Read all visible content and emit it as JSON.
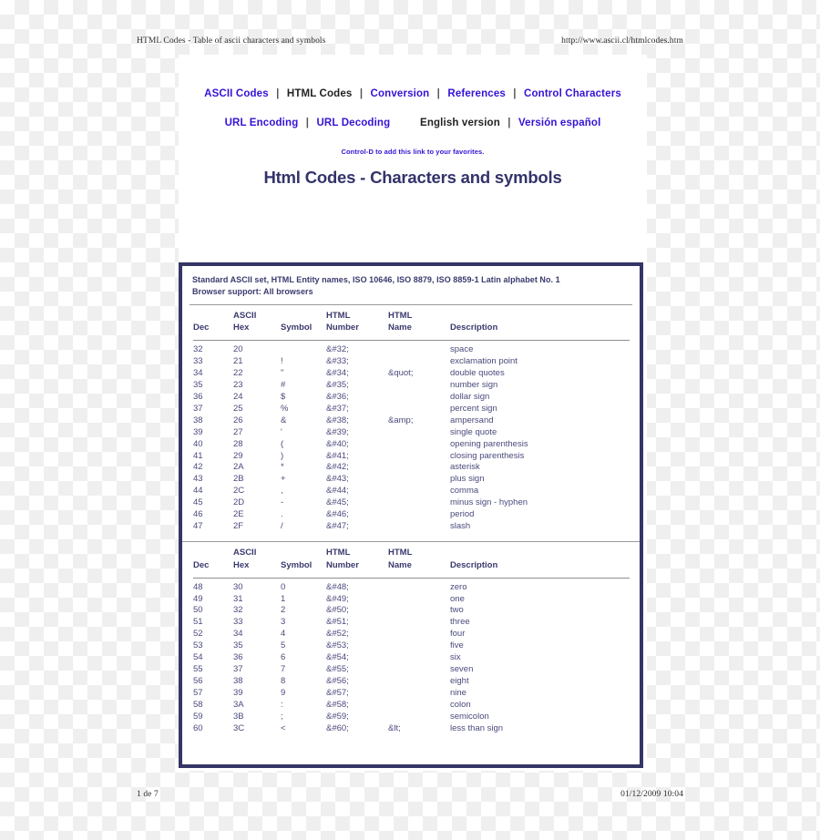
{
  "running_head": {
    "left": "HTML Codes - Table of ascii characters and symbols",
    "right": "http://www.ascii.cl/htmlcodes.htm"
  },
  "running_foot": {
    "left": "1 de 7",
    "right": "01/12/2009 10:04"
  },
  "nav": {
    "row1": [
      {
        "label": "ASCII Codes",
        "current": false
      },
      {
        "label": "HTML Codes",
        "current": true
      },
      {
        "label": "Conversion",
        "current": false
      },
      {
        "label": "References",
        "current": false
      },
      {
        "label": "Control Characters",
        "current": false
      }
    ],
    "row2_left": [
      {
        "label": "URL Encoding",
        "current": false
      },
      {
        "label": "URL Decoding",
        "current": false
      }
    ],
    "row2_right": [
      {
        "label": "English version",
        "current": true
      },
      {
        "label": "Versión español",
        "current": false
      }
    ],
    "separator": "|"
  },
  "favorites_tip": "Control-D to add this link to your favorites.",
  "page_title": "Html Codes - Characters and symbols",
  "table_box": {
    "meta_line1": "Standard ASCII set, HTML Entity names, ISO 10646, ISO 8879, ISO 8859-1 Latin alphabet No. 1",
    "meta_line2": "Browser support: All browsers",
    "headers": {
      "group": "ASCII",
      "dec": "Dec",
      "hex": "Hex",
      "symbol": "Symbol",
      "html_number_l1": "HTML",
      "html_number_l2": "Number",
      "html_name_l1": "HTML",
      "html_name_l2": "Name",
      "description": "Description"
    },
    "section1": [
      {
        "dec": "32",
        "hex": "20",
        "symbol": "",
        "number": "&#32;",
        "name": "",
        "description": "space"
      },
      {
        "dec": "33",
        "hex": "21",
        "symbol": "!",
        "number": "&#33;",
        "name": "",
        "description": "exclamation point"
      },
      {
        "dec": "34",
        "hex": "22",
        "symbol": "\"",
        "number": "&#34;",
        "name": "&quot;",
        "description": "double quotes"
      },
      {
        "dec": "35",
        "hex": "23",
        "symbol": "#",
        "number": "&#35;",
        "name": "",
        "description": "number sign"
      },
      {
        "dec": "36",
        "hex": "24",
        "symbol": "$",
        "number": "&#36;",
        "name": "",
        "description": "dollar sign"
      },
      {
        "dec": "37",
        "hex": "25",
        "symbol": "%",
        "number": "&#37;",
        "name": "",
        "description": "percent sign"
      },
      {
        "dec": "38",
        "hex": "26",
        "symbol": "&",
        "number": "&#38;",
        "name": "&amp;",
        "description": "ampersand"
      },
      {
        "dec": "39",
        "hex": "27",
        "symbol": "'",
        "number": "&#39;",
        "name": "",
        "description": "single quote"
      },
      {
        "dec": "40",
        "hex": "28",
        "symbol": "(",
        "number": "&#40;",
        "name": "",
        "description": "opening parenthesis"
      },
      {
        "dec": "41",
        "hex": "29",
        "symbol": ")",
        "number": "&#41;",
        "name": "",
        "description": "closing parenthesis"
      },
      {
        "dec": "42",
        "hex": "2A",
        "symbol": "*",
        "number": "&#42;",
        "name": "",
        "description": "asterisk"
      },
      {
        "dec": "43",
        "hex": "2B",
        "symbol": "+",
        "number": "&#43;",
        "name": "",
        "description": "plus sign"
      },
      {
        "dec": "44",
        "hex": "2C",
        "symbol": ",",
        "number": "&#44;",
        "name": "",
        "description": "comma"
      },
      {
        "dec": "45",
        "hex": "2D",
        "symbol": "-",
        "number": "&#45;",
        "name": "",
        "description": "minus sign - hyphen"
      },
      {
        "dec": "46",
        "hex": "2E",
        "symbol": ".",
        "number": "&#46;",
        "name": "",
        "description": "period"
      },
      {
        "dec": "47",
        "hex": "2F",
        "symbol": "/",
        "number": "&#47;",
        "name": "",
        "description": "slash"
      }
    ],
    "section2": [
      {
        "dec": "48",
        "hex": "30",
        "symbol": "0",
        "number": "&#48;",
        "name": "",
        "description": "zero"
      },
      {
        "dec": "49",
        "hex": "31",
        "symbol": "1",
        "number": "&#49;",
        "name": "",
        "description": "one"
      },
      {
        "dec": "50",
        "hex": "32",
        "symbol": "2",
        "number": "&#50;",
        "name": "",
        "description": "two"
      },
      {
        "dec": "51",
        "hex": "33",
        "symbol": "3",
        "number": "&#51;",
        "name": "",
        "description": "three"
      },
      {
        "dec": "52",
        "hex": "34",
        "symbol": "4",
        "number": "&#52;",
        "name": "",
        "description": "four"
      },
      {
        "dec": "53",
        "hex": "35",
        "symbol": "5",
        "number": "&#53;",
        "name": "",
        "description": "five"
      },
      {
        "dec": "54",
        "hex": "36",
        "symbol": "6",
        "number": "&#54;",
        "name": "",
        "description": "six"
      },
      {
        "dec": "55",
        "hex": "37",
        "symbol": "7",
        "number": "&#55;",
        "name": "",
        "description": "seven"
      },
      {
        "dec": "56",
        "hex": "38",
        "symbol": "8",
        "number": "&#56;",
        "name": "",
        "description": "eight"
      },
      {
        "dec": "57",
        "hex": "39",
        "symbol": "9",
        "number": "&#57;",
        "name": "",
        "description": "nine"
      },
      {
        "dec": "58",
        "hex": "3A",
        "symbol": ":",
        "number": "&#58;",
        "name": "",
        "description": "colon"
      },
      {
        "dec": "59",
        "hex": "3B",
        "symbol": ";",
        "number": "&#59;",
        "name": "",
        "description": "semicolon"
      },
      {
        "dec": "60",
        "hex": "3C",
        "symbol": "<",
        "number": "&#60;",
        "name": "&lt;",
        "description": "less than sign"
      }
    ]
  },
  "colors": {
    "link": "#3712d6",
    "title": "#33336b",
    "table_border": "#353566",
    "table_text": "#4a4a7d",
    "header_text": "#3a3a6e"
  }
}
